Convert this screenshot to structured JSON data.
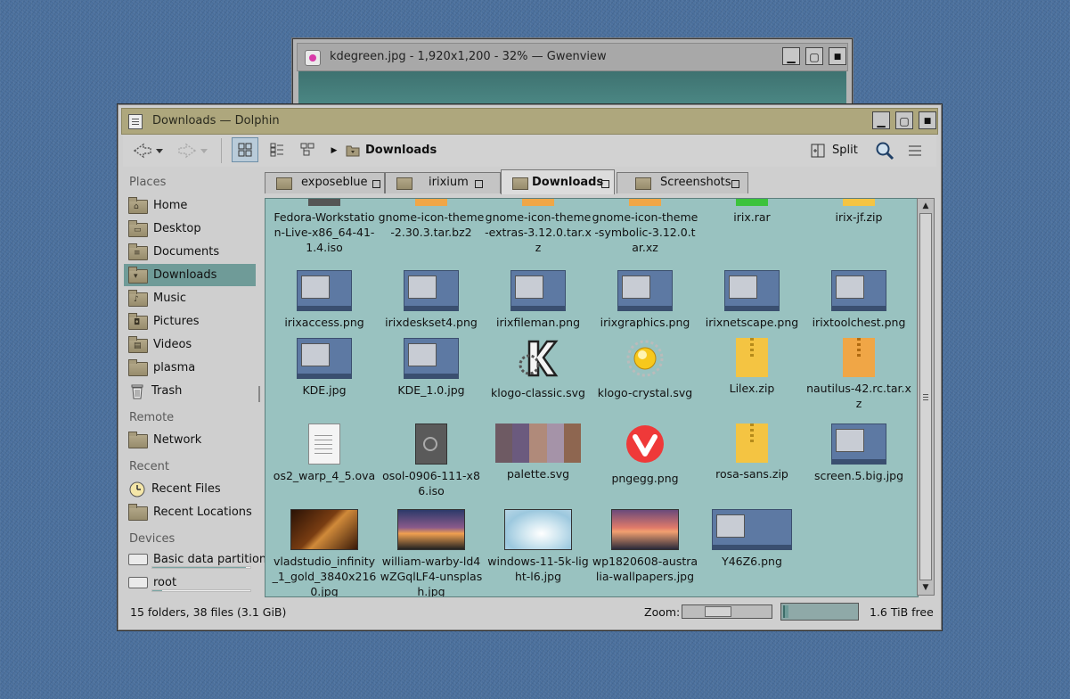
{
  "gwenview": {
    "title": "kdegreen.jpg - 1,920x1,200 - 32% — Gwenview"
  },
  "dolphin": {
    "title": "Downloads — Dolphin",
    "breadcrumb": "Downloads",
    "split_label": "Split",
    "places": {
      "headers": {
        "places": "Places",
        "remote": "Remote",
        "recent": "Recent",
        "devices": "Devices"
      },
      "items": [
        {
          "label": "Home",
          "icon": "home-folder-icon"
        },
        {
          "label": "Desktop",
          "icon": "desktop-folder-icon"
        },
        {
          "label": "Documents",
          "icon": "documents-folder-icon"
        },
        {
          "label": "Downloads",
          "icon": "downloads-folder-icon",
          "selected": true
        },
        {
          "label": "Music",
          "icon": "music-folder-icon"
        },
        {
          "label": "Pictures",
          "icon": "pictures-folder-icon"
        },
        {
          "label": "Videos",
          "icon": "videos-folder-icon"
        },
        {
          "label": "plasma",
          "icon": "folder-icon"
        },
        {
          "label": "Trash",
          "icon": "trash-icon"
        }
      ],
      "remote": [
        {
          "label": "Network",
          "icon": "network-folder-icon"
        }
      ],
      "recent": [
        {
          "label": "Recent Files",
          "icon": "clock-icon"
        },
        {
          "label": "Recent Locations",
          "icon": "folder-icon"
        }
      ],
      "devices": [
        {
          "label": "Basic data partition",
          "icon": "drive-icon",
          "usage": 0.95
        },
        {
          "label": "root",
          "icon": "drive-icon",
          "usage": 0.1
        }
      ]
    },
    "tabs": [
      {
        "label": "exposeblue"
      },
      {
        "label": "irixium"
      },
      {
        "label": "Downloads",
        "active": true
      },
      {
        "label": "Screenshots"
      }
    ],
    "files": [
      {
        "name": "Fedora-Workstation-Live-x86_64-41-1.4.iso",
        "kind": "partial",
        "color": "#555555"
      },
      {
        "name": "gnome-icon-theme-2.30.3.tar.bz2",
        "kind": "partial",
        "color": "#f0a646"
      },
      {
        "name": "gnome-icon-theme-extras-3.12.0.tar.xz",
        "kind": "partial",
        "color": "#f0a646"
      },
      {
        "name": "gnome-icon-theme-symbolic-3.12.0.tar.xz",
        "kind": "partial",
        "color": "#f0a646"
      },
      {
        "name": "irix.rar",
        "kind": "partial",
        "color": "#3cc33c"
      },
      {
        "name": "irix-jf.zip",
        "kind": "partial",
        "color": "#f4c442"
      },
      {
        "name": "irixaccess.png",
        "kind": "shot"
      },
      {
        "name": "irixdeskset4.png",
        "kind": "shot"
      },
      {
        "name": "irixfileman.png",
        "kind": "shot"
      },
      {
        "name": "irixgraphics.png",
        "kind": "shot"
      },
      {
        "name": "irixnetscape.png",
        "kind": "shot"
      },
      {
        "name": "irixtoolchest.png",
        "kind": "shot"
      },
      {
        "name": "KDE.jpg",
        "kind": "shot"
      },
      {
        "name": "KDE_1.0.jpg",
        "kind": "shot"
      },
      {
        "name": "klogo-classic.svg",
        "kind": "klogo"
      },
      {
        "name": "klogo-crystal.svg",
        "kind": "crystal"
      },
      {
        "name": "Lilex.zip",
        "kind": "zip"
      },
      {
        "name": "nautilus-42.rc.tar.xz",
        "kind": "zip-orange"
      },
      {
        "name": "os2_warp_4_5.ova",
        "kind": "doc"
      },
      {
        "name": "osol-0906-111-x86.iso",
        "kind": "iso"
      },
      {
        "name": "palette.svg",
        "kind": "palette",
        "colors": [
          "#6e5a63",
          "#6b5a7e",
          "#b08a7a",
          "#a593a8",
          "#8e6650"
        ]
      },
      {
        "name": "pngegg.png",
        "kind": "vivaldi"
      },
      {
        "name": "rosa-sans.zip",
        "kind": "zip"
      },
      {
        "name": "screen.5.big.jpg",
        "kind": "shot"
      },
      {
        "name": "vladstudio_infinity_1_gold_3840x2160.jpg",
        "kind": "photo",
        "bg": "linear-gradient(135deg,#2a1206 0%,#7a3d12 45%,#d08a3a 55%,#3a1a08 100%)"
      },
      {
        "name": "william-warby-ld4wZGqlLF4-unsplash.jpg",
        "kind": "photo",
        "bg": "linear-gradient(180deg,#2c3a6a 0%,#8a5a8a 45%,#f0a050 60%,#222 100%)"
      },
      {
        "name": "windows-11-5k-light-l6.jpg",
        "kind": "photo",
        "bg": "radial-gradient(ellipse at 55% 60%,#ffffff 0%,#cfe6f0 35%,#9cc8de 70%,#b8d6e6 100%)"
      },
      {
        "name": "wp1820608-australia-wallpapers.jpg",
        "kind": "photo",
        "bg": "linear-gradient(180deg,#6a4a7a 0%,#e07a6a 45%,#f2a070 55%,#2a2a3a 100%)"
      },
      {
        "name": "Y46Z6.png",
        "kind": "shot-wide"
      }
    ],
    "status": {
      "summary": "15 folders, 38 files (3.1 GiB)",
      "zoom_label": "Zoom:",
      "zoom_level": 0.35,
      "free_fraction": 0.05,
      "free": "1.6 TiB free"
    },
    "colors": {
      "selection": "#6f9b98",
      "view_background": "#99c2c0",
      "titlebar": "#aea77d"
    }
  }
}
